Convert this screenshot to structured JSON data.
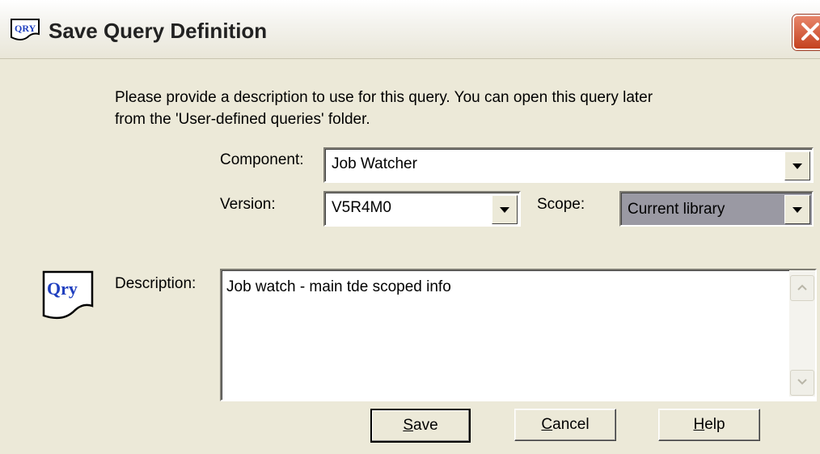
{
  "window": {
    "title": "Save Query Definition"
  },
  "instructions": {
    "line1": "Please provide a description to use for this query.  You can open this query later",
    "line2": "from the 'User-defined queries' folder."
  },
  "component": {
    "label": "Component:",
    "value": "Job Watcher"
  },
  "version": {
    "label": "Version:",
    "value": "V5R4M0"
  },
  "scope": {
    "label": "Scope:",
    "value": "Current library"
  },
  "description": {
    "label": "Description:",
    "value": "Job watch - main tde scoped info",
    "icon_text": "Qry"
  },
  "buttons": {
    "save": {
      "mnemonic": "S",
      "rest": "ave"
    },
    "cancel": {
      "mnemonic": "C",
      "rest": "ancel"
    },
    "help": {
      "mnemonic": "H",
      "rest": "elp"
    }
  },
  "colors": {
    "close_button": "#c4411f",
    "scope_field_bg": "#9a99a3",
    "qry_icon_text": "#1f3fbf"
  },
  "icons": {
    "title": "query-app-icon",
    "close": "close-icon",
    "field": "qry-document-icon"
  }
}
